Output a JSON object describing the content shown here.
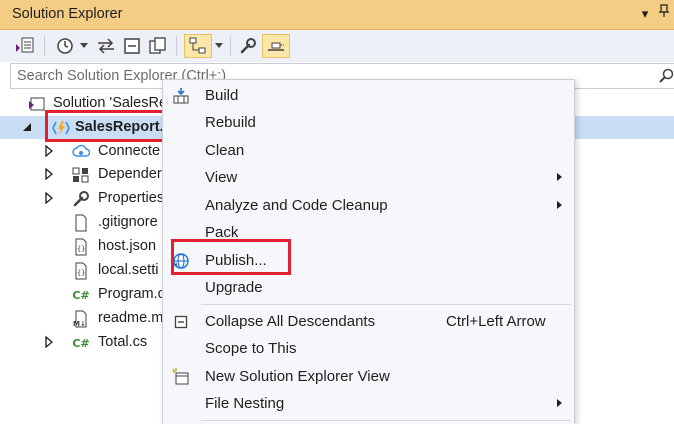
{
  "window": {
    "title": "Solution Explorer",
    "pin_glyph": "▾",
    "pin2_glyph": "⊿"
  },
  "search": {
    "placeholder": "Search Solution Explorer (Ctrl+;)"
  },
  "tree": {
    "solution": "Solution 'SalesRe",
    "project": "SalesReport.",
    "items": [
      {
        "label": "Connecte",
        "icon": "connected-services-icon",
        "expandable": true
      },
      {
        "label": "Depender",
        "icon": "dependencies-icon",
        "expandable": true
      },
      {
        "label": "Properties",
        "icon": "properties-wrench-icon",
        "expandable": true
      },
      {
        "label": ".gitignore",
        "icon": "file-icon",
        "expandable": false
      },
      {
        "label": "host.json",
        "icon": "json-file-icon",
        "expandable": false
      },
      {
        "label": "local.setti",
        "icon": "json-file-icon",
        "expandable": false
      },
      {
        "label": "Program.c",
        "icon": "csharp-file-icon",
        "expandable": false
      },
      {
        "label": "readme.m",
        "icon": "markdown-file-icon",
        "expandable": false
      },
      {
        "label": "Total.cs",
        "icon": "csharp-file-icon",
        "expandable": true
      }
    ]
  },
  "context_menu": {
    "build": "Build",
    "rebuild": "Rebuild",
    "clean": "Clean",
    "view": "View",
    "analyze": "Analyze and Code Cleanup",
    "pack": "Pack",
    "publish": "Publish...",
    "upgrade": "Upgrade",
    "collapse": "Collapse All Descendants",
    "collapse_shortcut": "Ctrl+Left Arrow",
    "scope": "Scope to This",
    "new_view": "New Solution Explorer View",
    "file_nesting": "File Nesting"
  },
  "colors": {
    "title_bar": "#f5cc84",
    "selection": "#c9def5",
    "highlight_box": "#e3202e",
    "menu_bg": "#f6f7fb"
  }
}
